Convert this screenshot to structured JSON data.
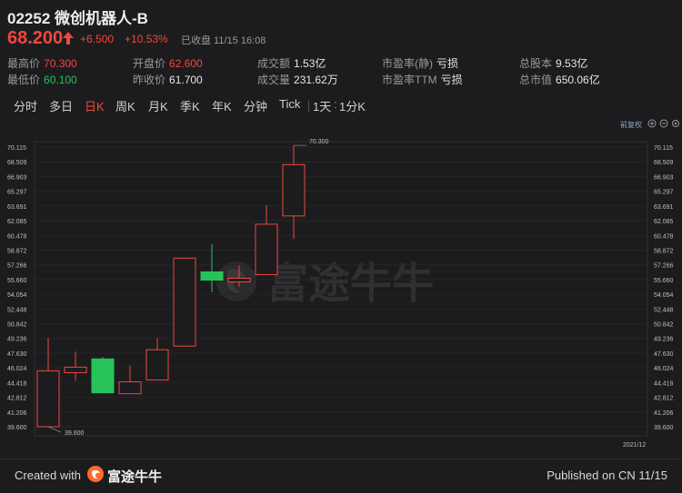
{
  "header": {
    "title": "02252 微创机器人-B",
    "price": "68.200",
    "change": "+6.500",
    "change_pct": "+10.53%",
    "status": "已收盘 11/15 16:08"
  },
  "stats": [
    {
      "label": "最高价",
      "value": "70.300",
      "color": "red"
    },
    {
      "label": "开盘价",
      "value": "62.600",
      "color": "red"
    },
    {
      "label": "成交额",
      "value": "1.53亿",
      "color": ""
    },
    {
      "label": "市盈率(静)",
      "value": "亏损",
      "color": ""
    },
    {
      "label": "总股本",
      "value": "9.53亿",
      "color": ""
    },
    {
      "label": "最低价",
      "value": "60.100",
      "color": "green"
    },
    {
      "label": "昨收价",
      "value": "61.700",
      "color": ""
    },
    {
      "label": "成交量",
      "value": "231.62万",
      "color": ""
    },
    {
      "label": "市盈率TTM",
      "value": "亏损",
      "color": ""
    },
    {
      "label": "总市值",
      "value": "650.06亿",
      "color": ""
    }
  ],
  "tabs": [
    "分时",
    "多日",
    "日K",
    "周K",
    "月K",
    "季K",
    "年K",
    "分钟",
    "Tick",
    "1天",
    "1分K"
  ],
  "active_tab": "日K",
  "restore_label": "前复权",
  "footer": {
    "created": "Created with",
    "brand": "富途牛牛",
    "published": "Published on CN 11/15"
  },
  "watermark": "富途牛牛",
  "colors": {
    "up": "#f0473e",
    "down": "#27c35a",
    "bg": "#1c1c1e"
  },
  "chart_data": {
    "type": "candlestick",
    "y_ticks": [
      "70.115",
      "68.509",
      "66.903",
      "65.297",
      "63.691",
      "62.085",
      "60.478",
      "58.872",
      "57.266",
      "55.660",
      "54.054",
      "52.448",
      "50.842",
      "49.236",
      "47.630",
      "46.024",
      "44.418",
      "42.812",
      "41.206",
      "39.600"
    ],
    "ylim": [
      39.6,
      70.115
    ],
    "x_label": "2021/12",
    "high_label": "70.300",
    "low_label": "39.600",
    "candles": [
      {
        "o": 39.6,
        "c": 45.7,
        "h": 49.3,
        "l": 39.6
      },
      {
        "o": 45.5,
        "c": 46.1,
        "h": 47.8,
        "l": 44.6
      },
      {
        "o": 47.0,
        "c": 43.3,
        "h": 47.2,
        "l": 43.3
      },
      {
        "o": 43.2,
        "c": 44.5,
        "h": 46.3,
        "l": 43.2
      },
      {
        "o": 44.7,
        "c": 48.0,
        "h": 49.3,
        "l": 44.7
      },
      {
        "o": 48.4,
        "c": 58.0,
        "h": 58.0,
        "l": 48.4
      },
      {
        "o": 56.5,
        "c": 55.6,
        "h": 59.5,
        "l": 54.3
      },
      {
        "o": 55.4,
        "c": 55.8,
        "h": 57.2,
        "l": 54.9
      },
      {
        "o": 56.2,
        "c": 61.7,
        "h": 63.8,
        "l": 56.2
      },
      {
        "o": 62.6,
        "c": 68.2,
        "h": 70.3,
        "l": 60.1
      }
    ]
  }
}
